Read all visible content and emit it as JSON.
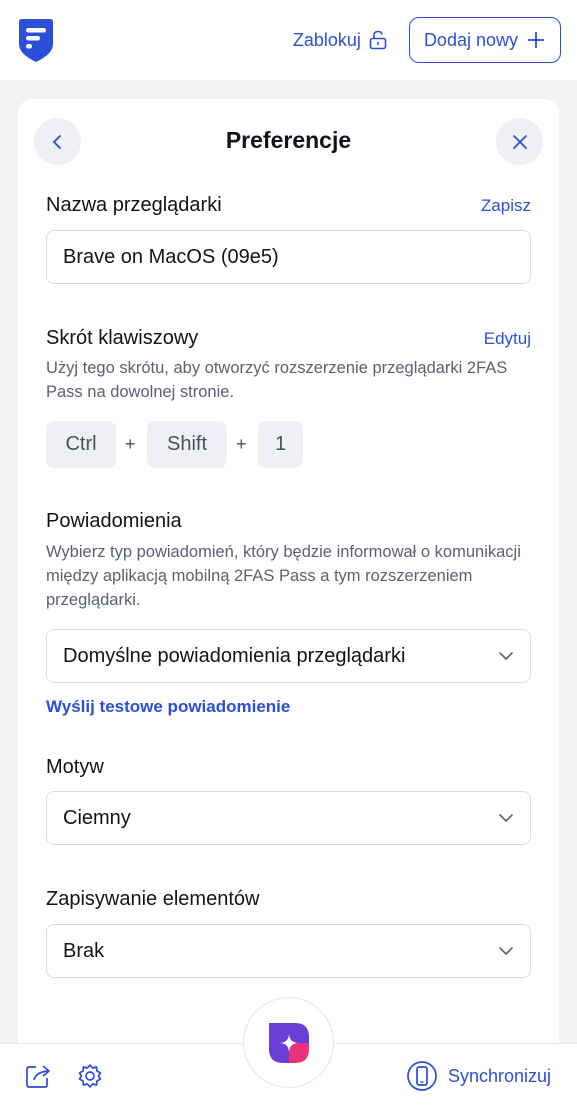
{
  "header": {
    "logo": "2fas-shield-logo",
    "lock_label": "Zablokuj",
    "add_label": "Dodaj nowy"
  },
  "card": {
    "title": "Preferencje",
    "browser_name": {
      "label": "Nazwa przeglądarki",
      "action": "Zapisz",
      "value": "Brave on MacOS (09e5)"
    },
    "shortcut": {
      "label": "Skrót klawiszowy",
      "action": "Edytuj",
      "description": "Użyj tego skrótu, aby otworzyć rozszerzenie przeglądarki 2FAS Pass na dowolnej stronie.",
      "keys": [
        "Ctrl",
        "Shift",
        "1"
      ],
      "separator": "+"
    },
    "notifications": {
      "label": "Powiadomienia",
      "description": "Wybierz typ powiadomień, który będzie informował o komunikacji między aplikacją mobilną 2FAS Pass a tym rozszerzeniem przeglądarki.",
      "selected": "Domyślne powiadomienia przeglądarki",
      "test_link": "Wyślij testowe powiadomienie"
    },
    "theme": {
      "label": "Motyw",
      "selected": "Ciemny"
    },
    "saving": {
      "label": "Zapisywanie elementów",
      "selected": "Brak"
    }
  },
  "footer": {
    "sync_label": "Synchronizuj"
  },
  "colors": {
    "accent": "#2b4fd8",
    "background": "#f2f3f5",
    "card": "#ffffff",
    "logo_pink": "#e8317a",
    "logo_purple": "#6a3fd8"
  }
}
